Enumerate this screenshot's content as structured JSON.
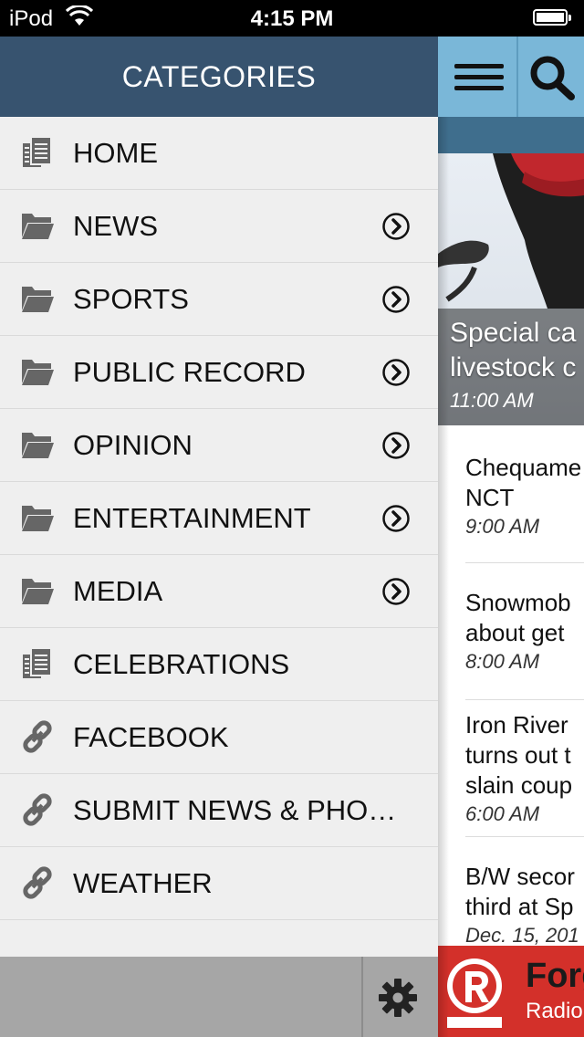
{
  "status_bar": {
    "carrier": "iPod",
    "time": "4:15 PM"
  },
  "menu": {
    "title": "CATEGORIES",
    "items": [
      {
        "label": "HOME",
        "icon": "document-icon",
        "has_arrow": false
      },
      {
        "label": "NEWS",
        "icon": "folder-icon",
        "has_arrow": true
      },
      {
        "label": "SPORTS",
        "icon": "folder-icon",
        "has_arrow": true
      },
      {
        "label": "PUBLIC RECORD",
        "icon": "folder-icon",
        "has_arrow": true
      },
      {
        "label": "OPINION",
        "icon": "folder-icon",
        "has_arrow": true
      },
      {
        "label": "ENTERTAINMENT",
        "icon": "folder-icon",
        "has_arrow": true
      },
      {
        "label": "MEDIA",
        "icon": "folder-icon",
        "has_arrow": true
      },
      {
        "label": "CELEBRATIONS",
        "icon": "document-icon",
        "has_arrow": false
      },
      {
        "label": "FACEBOOK",
        "icon": "link-icon",
        "has_arrow": false
      },
      {
        "label": "SUBMIT NEWS & PHOTOS",
        "icon": "link-icon",
        "has_arrow": false
      },
      {
        "label": "WEATHER",
        "icon": "link-icon",
        "has_arrow": false
      }
    ]
  },
  "content": {
    "hero": {
      "title_line1": "Special ca",
      "title_line2": "livestock c",
      "time": "11:00 AM"
    },
    "stories": [
      {
        "lines": [
          "Chequame",
          "NCT"
        ],
        "time": "9:00 AM"
      },
      {
        "lines": [
          "Snowmob",
          "about get"
        ],
        "time": "8:00 AM"
      },
      {
        "lines": [
          "Iron River",
          "turns out t",
          "slain coup"
        ],
        "time": "6:00 AM"
      },
      {
        "lines": [
          "B/W secor",
          "third at Sp"
        ],
        "time": "Dec. 15, 201"
      }
    ],
    "ad": {
      "line1": "Forg",
      "line2": "Radio"
    }
  },
  "colors": {
    "menu_header": "#37536f",
    "menu_bg": "#efefef",
    "topbar": "#7ab7d8",
    "subbar": "#3f6e8d",
    "ad_red": "#d3302a"
  }
}
